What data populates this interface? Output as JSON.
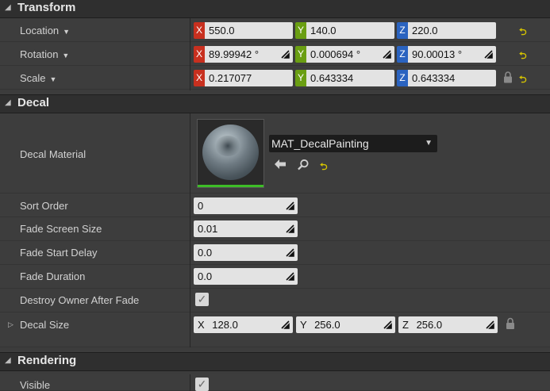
{
  "transform": {
    "title": "Transform",
    "location": {
      "label": "Location",
      "x": "550.0",
      "y": "140.0",
      "z": "220.0"
    },
    "rotation": {
      "label": "Rotation",
      "x": "89.99942 °",
      "y": "0.000694 °",
      "z": "90.00013 °"
    },
    "scale": {
      "label": "Scale",
      "x": "0.217077",
      "y": "0.643334",
      "z": "0.643334"
    }
  },
  "decal": {
    "title": "Decal",
    "decal_material": {
      "label": "Decal Material",
      "value": "MAT_DecalPainting"
    },
    "sort_order": {
      "label": "Sort Order",
      "value": "0"
    },
    "fade_screen_size": {
      "label": "Fade Screen Size",
      "value": "0.01"
    },
    "fade_start_delay": {
      "label": "Fade Start Delay",
      "value": "0.0"
    },
    "fade_duration": {
      "label": "Fade Duration",
      "value": "0.0"
    },
    "destroy_owner_after_fade": {
      "label": "Destroy Owner After Fade",
      "checked": true
    },
    "decal_size": {
      "label": "Decal Size",
      "x_label": "X",
      "y_label": "Y",
      "z_label": "Z",
      "x": "128.0",
      "y": "256.0",
      "z": "256.0"
    }
  },
  "rendering": {
    "title": "Rendering",
    "visible": {
      "label": "Visible",
      "checked": true
    }
  },
  "axis_labels": {
    "x": "X",
    "y": "Y",
    "z": "Z"
  },
  "glyphs": {
    "collapse": "◢",
    "dropdown": "▼",
    "expand": "▷",
    "check": "✓",
    "reset": "⮌"
  },
  "colors": {
    "axis_x": "#c8301f",
    "axis_y": "#6a9e12",
    "axis_z": "#2a63c0",
    "reset_arrow": "#d6c400",
    "thumbnail_bar": "#3dbd27"
  }
}
